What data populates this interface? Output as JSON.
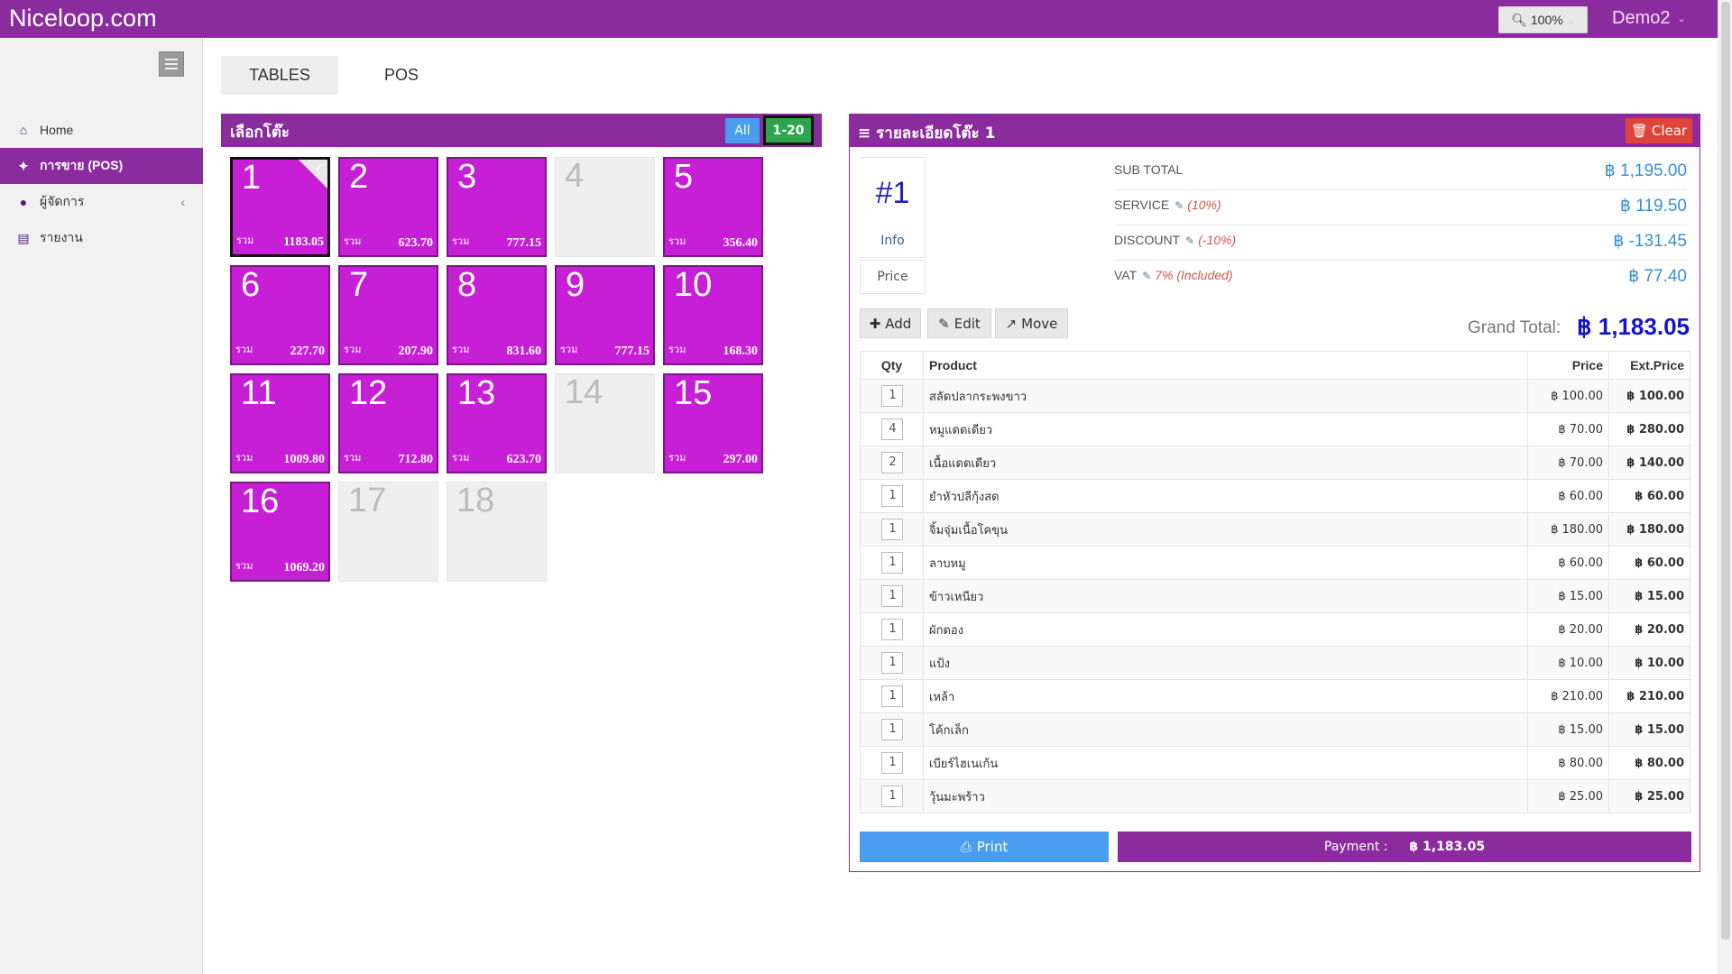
{
  "topbar": {
    "brand": "Niceloop.com",
    "zoom_label": "100%",
    "user_name": "Demo2"
  },
  "sidebar": {
    "items": [
      {
        "label": "Home",
        "icon": "home-icon"
      },
      {
        "label": "การขาย (POS)",
        "icon": "cutlery-icon"
      },
      {
        "label": "ผู้จัดการ",
        "icon": "user-icon"
      },
      {
        "label": "รายงาน",
        "icon": "bar-chart-icon"
      }
    ]
  },
  "tabs": [
    {
      "label": "TABLES"
    },
    {
      "label": "POS"
    }
  ],
  "picker": {
    "title": "เลือกโต๊ะ",
    "filter_all": "All",
    "filter_range": "1-20",
    "total_label": "รวม",
    "tables": [
      {
        "num": "1",
        "amount": "1183.05"
      },
      {
        "num": "2",
        "amount": "623.70"
      },
      {
        "num": "3",
        "amount": "777.15"
      },
      {
        "num": "4",
        "amount": ""
      },
      {
        "num": "5",
        "amount": "356.40"
      },
      {
        "num": "6",
        "amount": "227.70"
      },
      {
        "num": "7",
        "amount": "207.90"
      },
      {
        "num": "8",
        "amount": "831.60"
      },
      {
        "num": "9",
        "amount": "777.15"
      },
      {
        "num": "10",
        "amount": "168.30"
      },
      {
        "num": "11",
        "amount": "1009.80"
      },
      {
        "num": "12",
        "amount": "712.80"
      },
      {
        "num": "13",
        "amount": "623.70"
      },
      {
        "num": "14",
        "amount": ""
      },
      {
        "num": "15",
        "amount": "297.00"
      },
      {
        "num": "16",
        "amount": "1069.20"
      },
      {
        "num": "17",
        "amount": ""
      },
      {
        "num": "18",
        "amount": ""
      }
    ]
  },
  "detail": {
    "title": "รายละเอียดโต๊ะ 1",
    "clear_label": "Clear",
    "table_num": "#1",
    "info_label": "Info",
    "price_label": "Price",
    "summary": [
      {
        "label": "SUB TOTAL",
        "note": "",
        "value": "฿ 1,195.00"
      },
      {
        "label": "SERVICE",
        "note": "(10%)",
        "value": "฿ 119.50"
      },
      {
        "label": "DISCOUNT",
        "note": "(-10%)",
        "value": "฿ -131.45"
      },
      {
        "label": "VAT",
        "note": "7% (Included)",
        "value": "฿ 77.40"
      }
    ],
    "add_label": "Add",
    "edit_label": "Edit",
    "move_label": "Move",
    "grand_total_label": "Grand Total:",
    "grand_total_value": "฿ 1,183.05",
    "columns": {
      "qty": "Qty",
      "product": "Product",
      "price": "Price",
      "ext": "Ext.Price"
    },
    "items": [
      {
        "qty": "1",
        "product": "สลัดปลากระพงขาว",
        "price": "฿ 100.00",
        "ext": "฿ 100.00"
      },
      {
        "qty": "4",
        "product": "หมูแดดเดียว",
        "price": "฿ 70.00",
        "ext": "฿ 280.00"
      },
      {
        "qty": "2",
        "product": "เนื้อแดดเดียว",
        "price": "฿ 70.00",
        "ext": "฿ 140.00"
      },
      {
        "qty": "1",
        "product": "ยำหัวปลีกุ้งสด",
        "price": "฿ 60.00",
        "ext": "฿ 60.00"
      },
      {
        "qty": "1",
        "product": "จิ้มจุ่มเนื้อโคขุน",
        "price": "฿ 180.00",
        "ext": "฿ 180.00"
      },
      {
        "qty": "1",
        "product": "ลาบหมู",
        "price": "฿ 60.00",
        "ext": "฿ 60.00"
      },
      {
        "qty": "1",
        "product": "ข้าวเหนียว",
        "price": "฿ 15.00",
        "ext": "฿ 15.00"
      },
      {
        "qty": "1",
        "product": "ผักดอง",
        "price": "฿ 20.00",
        "ext": "฿ 20.00"
      },
      {
        "qty": "1",
        "product": "แป้ง",
        "price": "฿ 10.00",
        "ext": "฿ 10.00"
      },
      {
        "qty": "1",
        "product": "เหล้า",
        "price": "฿ 210.00",
        "ext": "฿ 210.00"
      },
      {
        "qty": "1",
        "product": "โค้กเล็ก",
        "price": "฿ 15.00",
        "ext": "฿ 15.00"
      },
      {
        "qty": "1",
        "product": "เบียร์ไฮเนเก้น",
        "price": "฿ 80.00",
        "ext": "฿ 80.00"
      },
      {
        "qty": "1",
        "product": "วุ้นมะพร้าว",
        "price": "฿ 25.00",
        "ext": "฿ 25.00"
      }
    ],
    "print_label": "Print",
    "payment_label": "Payment :",
    "payment_value": "฿ 1,183.05"
  },
  "colors": {
    "brand_purple": "#8a2c9e",
    "tile_magenta": "#c61fd6",
    "blue_button": "#4a9cf0",
    "green_button": "#2ea44f",
    "red_button": "#e0433a"
  }
}
